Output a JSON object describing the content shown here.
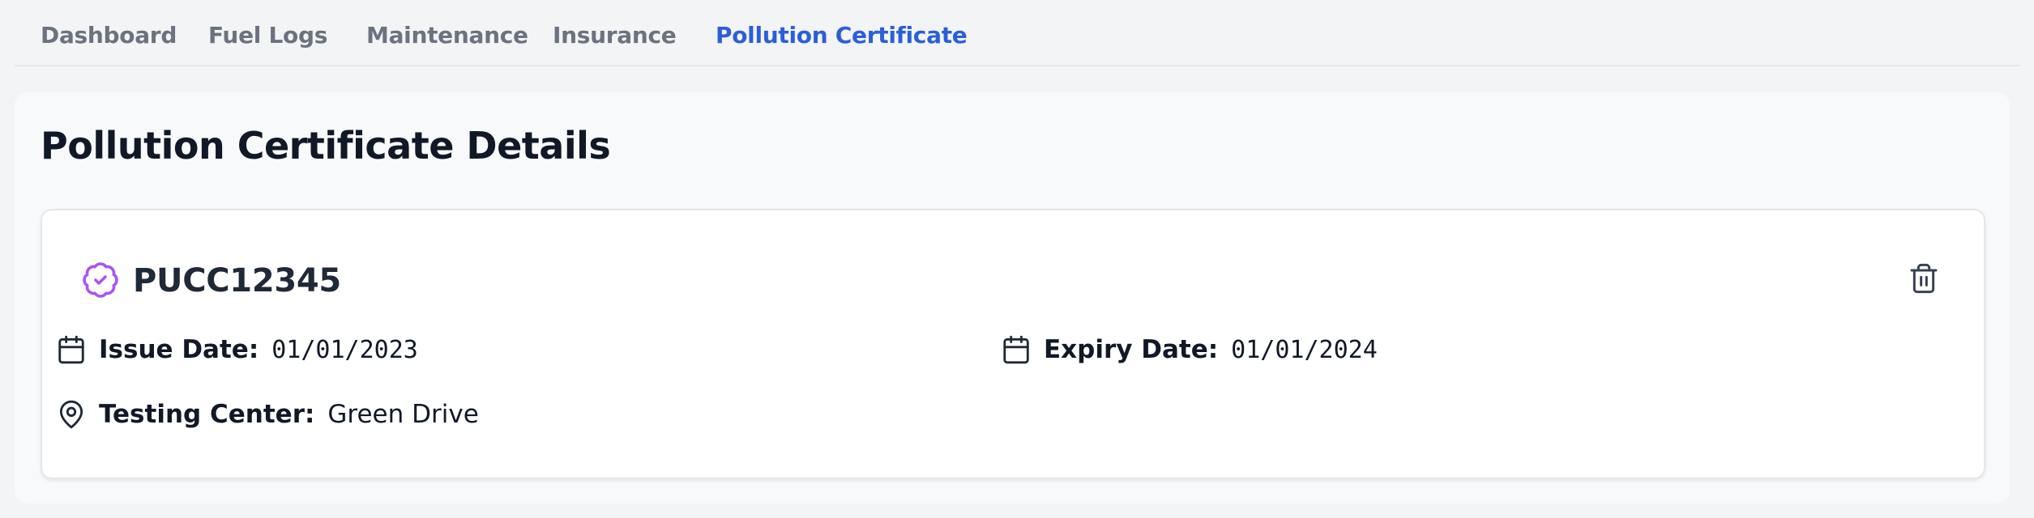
{
  "tabs": [
    {
      "label": "Dashboard"
    },
    {
      "label": "Fuel Logs"
    },
    {
      "label": "Maintenance"
    },
    {
      "label": "Insurance"
    },
    {
      "label": "Pollution Certificate",
      "active": true
    }
  ],
  "page": {
    "title": "Pollution Certificate Details"
  },
  "certificate": {
    "number": "PUCC12345",
    "status_icon": "badge-check-icon",
    "delete_icon": "trash-icon",
    "issue_date_label": "Issue Date:",
    "issue_date": "01/01/2023",
    "expiry_date_label": "Expiry Date:",
    "expiry_date": "01/01/2024",
    "testing_center_label": "Testing Center:",
    "testing_center": "Green Drive"
  },
  "colors": {
    "accent": "#2b5fd9",
    "badge": "#a855f7",
    "tab_inactive": "#6b7280"
  }
}
